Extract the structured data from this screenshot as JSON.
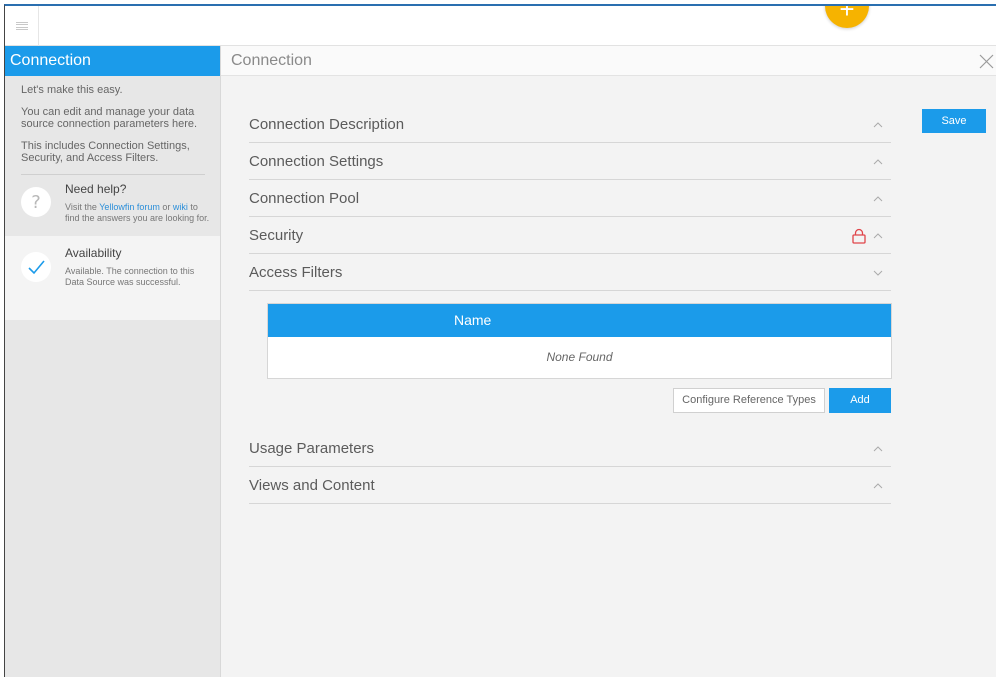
{
  "sidebar": {
    "title": "Connection",
    "intro": [
      "Let's make this easy.",
      "You can edit and manage your data source connection parameters here.",
      "This includes Connection Settings, Security, and Access Filters."
    ],
    "help": {
      "icon": "question-mark-icon",
      "title": "Need help?",
      "text_before": "Visit the ",
      "forum_link": "Yellowfin forum",
      "text_or": " or ",
      "wiki_link": "wiki",
      "text_after": " to find the answers you are looking for."
    },
    "availability": {
      "icon": "checkmark-icon",
      "title": "Availability",
      "text": "Available. The connection to this Data Source was successful."
    }
  },
  "main": {
    "title": "Connection",
    "save_label": "Save",
    "sections": [
      {
        "label": "Connection Description",
        "state": "collapsed"
      },
      {
        "label": "Connection Settings",
        "state": "collapsed"
      },
      {
        "label": "Connection Pool",
        "state": "collapsed"
      },
      {
        "label": "Security",
        "state": "collapsed",
        "locked": true
      },
      {
        "label": "Access Filters",
        "state": "expanded"
      }
    ],
    "access_filters": {
      "column_header": "Name",
      "empty_text": "None Found",
      "configure_label": "Configure Reference Types",
      "add_label": "Add"
    },
    "sections_after": [
      {
        "label": "Usage Parameters",
        "state": "collapsed"
      },
      {
        "label": "Views and Content",
        "state": "collapsed"
      }
    ]
  },
  "colors": {
    "accent": "#1b9bea",
    "fab": "#f6b300",
    "lock": "#e0454a",
    "link": "#2c8fd9"
  }
}
